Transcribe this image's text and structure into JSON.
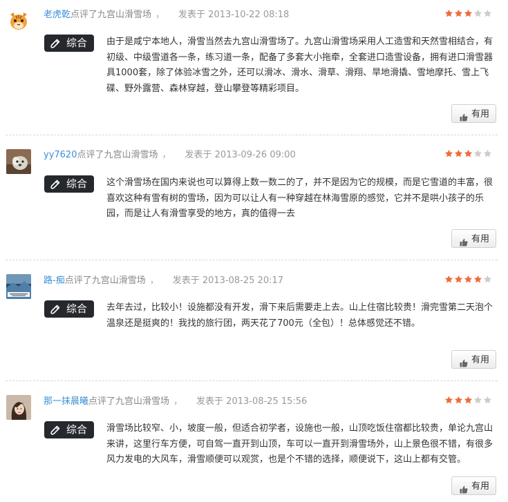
{
  "reviews": [
    {
      "username": "老虎乾",
      "action": "点评了九宫山滑雪场",
      "separator": "，",
      "posted": "发表于 2013-10-22 08:18",
      "rating": 3,
      "max_rating": 5,
      "tag": "综合",
      "content": "由于是咸宁本地人，滑雪当然去九宫山滑雪场了。九宫山滑雪场采用人工造雪和天然雪相结合，有初级、中级雪道各一条，练习道一条，配备了多套大小拖牵，全套进口造雪设备，拥有进口滑雪器具1000套，除了体验冰雪之外，还可以滑冰、滑水、滑草、滑翔、旱地滑撬、雪地摩托、雪上飞碟、野外露营、森林穿越，登山攀登等精彩项目。",
      "useful_label": "有用"
    },
    {
      "username": "yy7620",
      "action": "点评了九宫山滑雪场",
      "separator": "，",
      "posted": "发表于 2013-09-26 09:00",
      "rating": 3,
      "max_rating": 5,
      "tag": "综合",
      "content": "这个滑雪场在国内来说也可以算得上数一数二的了，并不是因为它的规模，而是它雪道的丰富，很喜欢这种有雪有树的雪场，因为可以让人有一种穿越在林海雪原的感觉，它并不是哄小孩子的乐园，而是让人有滑雪享受的地方，真的值得一去",
      "useful_label": "有用"
    },
    {
      "username": "路-痴",
      "action": "点评了九宫山滑雪场",
      "separator": "，",
      "posted": "发表于 2013-08-25 20:17",
      "rating": 4,
      "max_rating": 5,
      "tag": "综合",
      "content": "去年去过，比较小！设施都没有开发，滑下来后需要走上去。山上住宿比较贵！滑完雪第二天泡个温泉还是挺爽的！我找的旅行团，两天花了700元（全包）！总体感觉还不错。",
      "useful_label": "有用"
    },
    {
      "username": "那一抹晨曦",
      "action": "点评了九宫山滑雪场",
      "separator": "，",
      "posted": "发表于 2013-08-25 15:56",
      "rating": 3,
      "max_rating": 5,
      "tag": "综合",
      "content": "滑雪场比较窄、小，坡度一般，但适合初学者，设施也一般，山顶吃饭住宿都比较贵，单论九宫山来讲，这里行车方便，可自驾一直开到山顶，车可以一直开到滑雪场外，山上景色很不错，有很多风力发电的大风车，滑雪顺便可以观赏，也是个不错的选择，顺便说下，这山上都有交管。",
      "useful_label": "有用"
    }
  ],
  "colors": {
    "username": "#3a8fd8",
    "star_on": "#ef6b3a",
    "star_off": "#cccccc",
    "tag_bg": "#25282d"
  },
  "icons": {
    "tag": "pencil-icon",
    "useful": "thumbs-up-icon"
  }
}
